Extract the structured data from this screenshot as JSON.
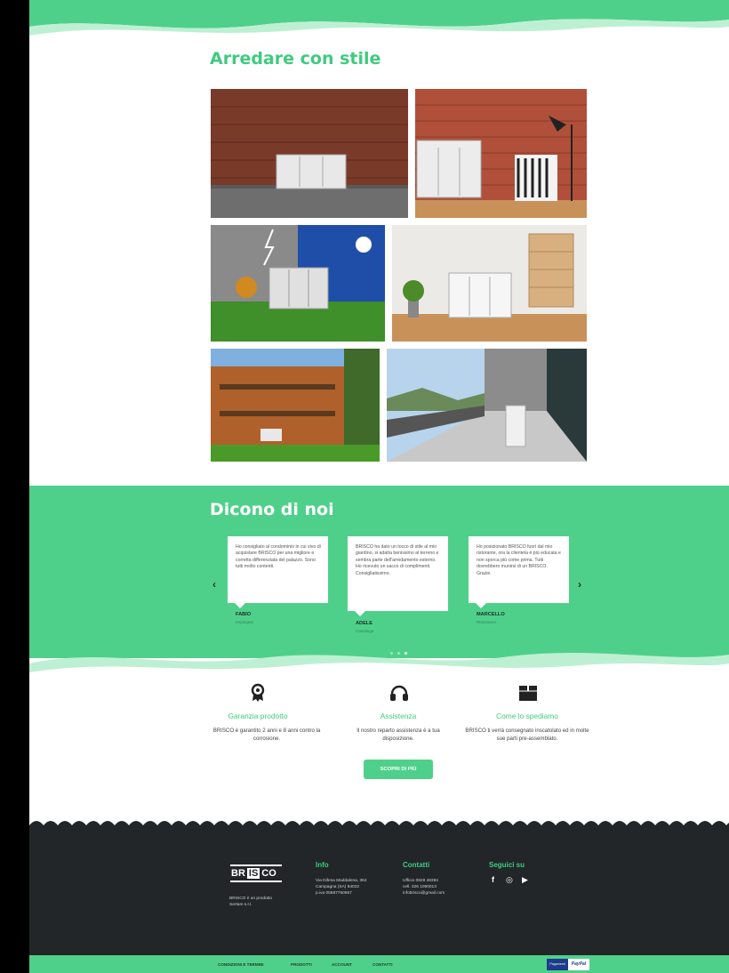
{
  "gallery": {
    "title": "Arredare con stile"
  },
  "testimonials": {
    "title": "Dicono di noi",
    "items": [
      {
        "text": "Ho consigliato al condominio in cui vivo di acquistare BRISCO per una migliore e corretta differenziata del palazzo. Sono tutti molto contenti.",
        "name": "FABIO",
        "role": "Impiegato"
      },
      {
        "text": "BRISCO ha dato un tocco di stile al mio giardino, si adatta benissimo al terreno e sembra parte dell'arredamento esterno. Ho ricevuto un sacco di complimenti. Consigliatissimo.",
        "name": "ADELE",
        "role": "Casalinga"
      },
      {
        "text": "Ho posizionato BRISCO fuori dal mio ristorante, ora la clientela è più educata e non sporca più come prima. Tutti dovrebbero munirsi di un BRISCO. Grazie.",
        "name": "MARCELLO",
        "role": "Ristoratore"
      }
    ],
    "prev_icon": "chevron-left-icon",
    "next_icon": "chevron-right-icon",
    "prev_glyph": "‹",
    "next_glyph": "›"
  },
  "features": [
    {
      "icon": "award-icon",
      "title": "Garanzia prodotto",
      "desc": "BRISCO è garantito 2 anni e 8 anni contro la corrosione."
    },
    {
      "icon": "headphones-icon",
      "title": "Assistenza",
      "desc": "Il nostro reparto assistenza è a tua disposizione."
    },
    {
      "icon": "box-icon",
      "title": "Come lo spediamo",
      "desc": "BRISCO ti verrà consegnato inscatolato ed in molte sue parti pre-assemblato."
    }
  ],
  "cta": {
    "label": "SCOPRI DI PIÙ"
  },
  "footer": {
    "logo": {
      "line1_left": "BR",
      "line1_mid": "IS",
      "line1_right": "CO"
    },
    "tagline": "BRISCO è un prodotto\nSertam s.r.l.",
    "info": {
      "title": "Info",
      "text": "Via Difesa Maddalena, 362\nCampagna (SA) 84022\np.iva 05687760657"
    },
    "contacts": {
      "title": "Contatti",
      "text": "Ufficio 0828 48394\ncell. 326 1090013\ninfobrisco@gmail.com"
    },
    "social": {
      "title": "Seguici su",
      "icons": [
        "facebook-icon",
        "instagram-icon",
        "youtube-icon"
      ],
      "glyphs": [
        "f",
        "◎",
        "▶"
      ]
    }
  },
  "bottom_links": [
    "CONDIZIONI E TERMINI",
    "PRODOTTI",
    "ACCOUNT",
    "CONTATTI"
  ],
  "payment": {
    "left": "Pagamenti",
    "right": "PayPal"
  },
  "colors": {
    "accent": "#4fd08a",
    "dark": "#232628"
  }
}
